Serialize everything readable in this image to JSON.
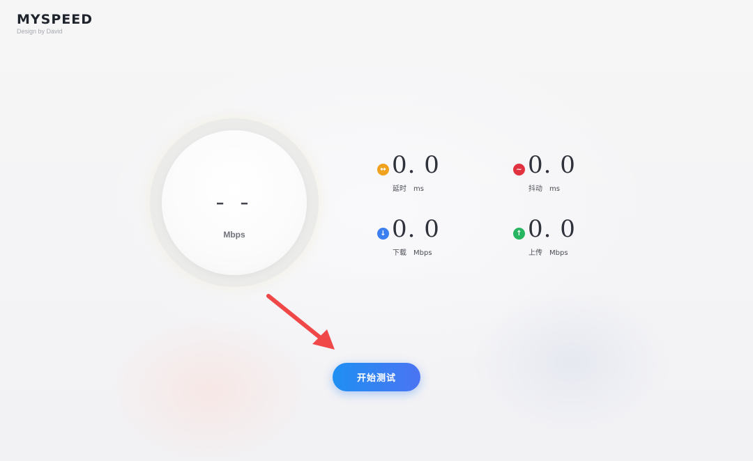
{
  "brand": {
    "title": "MYSPEED",
    "subtitle": "Design by David"
  },
  "gauge": {
    "value": "- -",
    "unit": "Mbps"
  },
  "metrics": [
    {
      "id": "latency",
      "label": "延时",
      "unit": "ms",
      "value": "0. 0",
      "icon": "latency-icon",
      "icon_glyph": "↔",
      "color": "#f0a21f"
    },
    {
      "id": "jitter",
      "label": "抖动",
      "unit": "ms",
      "value": "0. 0",
      "icon": "jitter-icon",
      "icon_glyph": "~",
      "color": "#e0323f"
    },
    {
      "id": "download",
      "label": "下载",
      "unit": "Mbps",
      "value": "0. 0",
      "icon": "download-icon",
      "icon_glyph": "↓",
      "color": "#3b7ff0"
    },
    {
      "id": "upload",
      "label": "上传",
      "unit": "Mbps",
      "value": "0. 0",
      "icon": "upload-icon",
      "icon_glyph": "↑",
      "color": "#27b561"
    }
  ],
  "start_button": {
    "label": "开始测试"
  },
  "annotation": {
    "arrow_color": "#f04848"
  }
}
